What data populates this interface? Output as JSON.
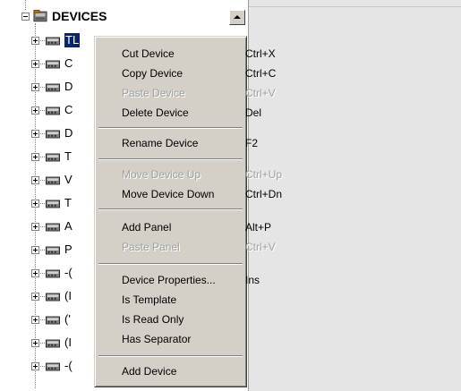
{
  "tree": {
    "root": {
      "label": "DEVICES",
      "expander": "minus",
      "icon": "devices-folder-icon"
    },
    "children": [
      {
        "label": "TL"
      },
      {
        "label": "C"
      },
      {
        "label": "D"
      },
      {
        "label": "C"
      },
      {
        "label": "D"
      },
      {
        "label": "T"
      },
      {
        "label": "V"
      },
      {
        "label": "T"
      },
      {
        "label": "A"
      },
      {
        "label": "P"
      },
      {
        "label": "-("
      },
      {
        "label": "(I"
      },
      {
        "label": "('"
      },
      {
        "label": "(I"
      },
      {
        "label": "-("
      }
    ]
  },
  "menu": {
    "items": [
      {
        "label": "Cut Device",
        "shortcut": "Ctrl+X",
        "disabled": false
      },
      {
        "label": "Copy Device",
        "shortcut": "Ctrl+C",
        "disabled": false
      },
      {
        "label": "Paste Device",
        "shortcut": "Ctrl+V",
        "disabled": true
      },
      {
        "label": "Delete Device",
        "shortcut": "Del",
        "disabled": false
      },
      {
        "label": "Rename Device",
        "shortcut": "F2",
        "disabled": false
      },
      {
        "label": "Move Device Up",
        "shortcut": "Ctrl+Up",
        "disabled": true
      },
      {
        "label": "Move Device Down",
        "shortcut": "Ctrl+Dn",
        "disabled": false
      },
      {
        "label": "Add Panel",
        "shortcut": "Alt+P",
        "disabled": false
      },
      {
        "label": "Paste Panel",
        "shortcut": "Ctrl+V",
        "disabled": true
      },
      {
        "label": "Device Properties...",
        "shortcut": "Ins",
        "disabled": false
      },
      {
        "label": "Is Template",
        "shortcut": "",
        "disabled": false
      },
      {
        "label": "Is Read Only",
        "shortcut": "",
        "disabled": false
      },
      {
        "label": "Has Separator",
        "shortcut": "",
        "disabled": false
      },
      {
        "label": "Add Device",
        "shortcut": "",
        "disabled": false
      }
    ]
  },
  "colors": {
    "selection": "#0a246a",
    "menu_bg": "#d4d0c8",
    "disabled_text": "#a0a0a0",
    "pane_bg": "#e5e5e5"
  }
}
